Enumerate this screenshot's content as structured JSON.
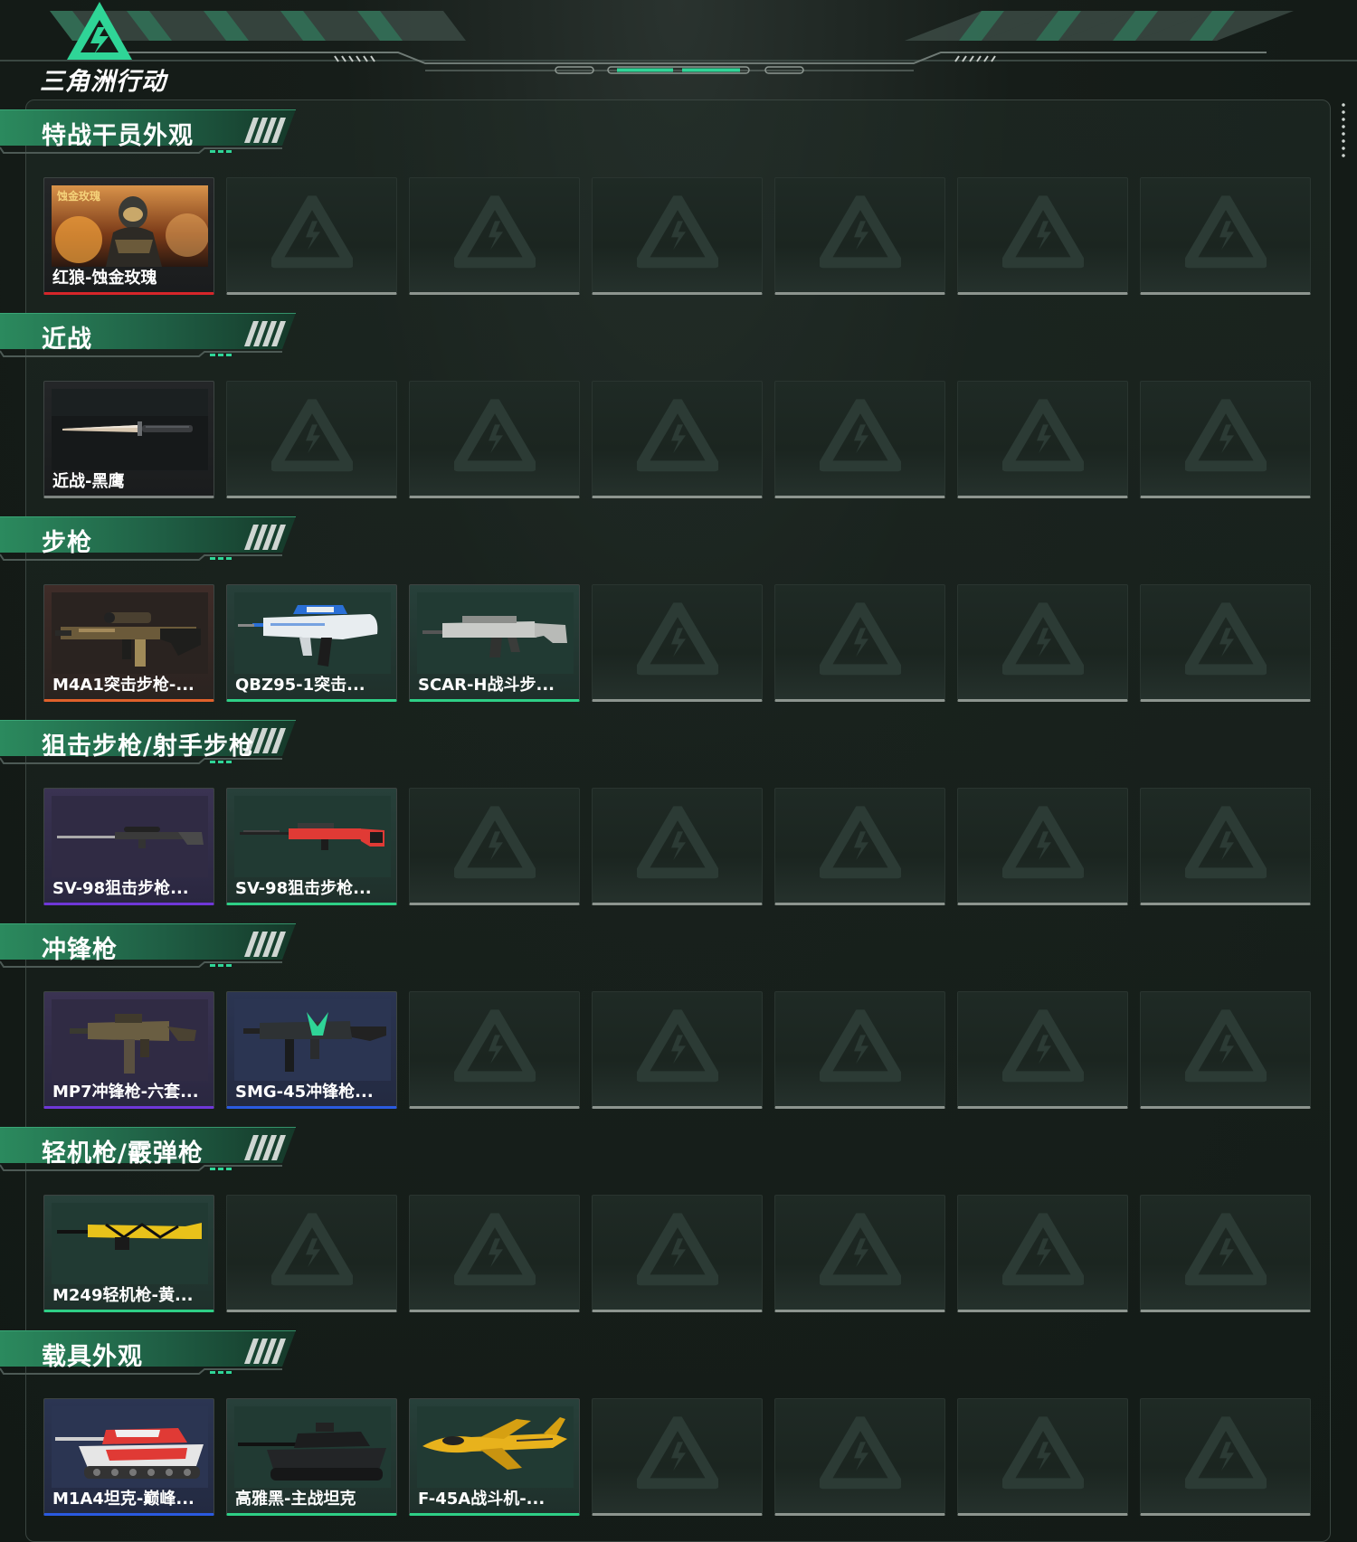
{
  "app": {
    "logo_text": "三角洲行动"
  },
  "theme": {
    "accent": "#2fd597",
    "panel_border": "#3a4540"
  },
  "sections": [
    {
      "title": "特战干员外观",
      "items": [
        {
          "label": "红狼-蚀金玫瑰",
          "rarity": "red",
          "bg": "dark",
          "thumb": "operator"
        },
        null,
        null,
        null,
        null,
        null,
        null
      ]
    },
    {
      "title": "近战",
      "items": [
        {
          "label": "近战-黑鹰",
          "rarity": "gray",
          "bg": "dark",
          "thumb": "knife"
        },
        null,
        null,
        null,
        null,
        null,
        null
      ]
    },
    {
      "title": "步枪",
      "items": [
        {
          "label": "M4A1突击步枪-...",
          "rarity": "orange",
          "bg": "orange",
          "thumb": "rifle-camo"
        },
        {
          "label": "QBZ95-1突击...",
          "rarity": "green",
          "bg": "green",
          "thumb": "rifle-bullpup"
        },
        {
          "label": "SCAR-H战斗步...",
          "rarity": "green",
          "bg": "green",
          "thumb": "rifle-scar"
        },
        null,
        null,
        null,
        null
      ]
    },
    {
      "title": "狙击步枪/射手步枪",
      "items": [
        {
          "label": "SV-98狙击步枪...",
          "rarity": "purple",
          "bg": "purple",
          "thumb": "sniper-dark"
        },
        {
          "label": "SV-98狙击步枪...",
          "rarity": "green",
          "bg": "green",
          "thumb": "sniper-red"
        },
        null,
        null,
        null,
        null,
        null
      ]
    },
    {
      "title": "冲锋枪",
      "items": [
        {
          "label": "MP7冲锋枪-六套...",
          "rarity": "purple",
          "bg": "purple",
          "thumb": "smg-camo"
        },
        {
          "label": "SMG-45冲锋枪...",
          "rarity": "blue",
          "bg": "blue",
          "thumb": "smg-green"
        },
        null,
        null,
        null,
        null,
        null
      ]
    },
    {
      "title": "轻机枪/霰弹枪",
      "items": [
        {
          "label": "M249轻机枪-黄...",
          "rarity": "green",
          "bg": "green",
          "thumb": "lmg-yellow"
        },
        null,
        null,
        null,
        null,
        null,
        null
      ]
    },
    {
      "title": "载具外观",
      "items": [
        {
          "label": "M1A4坦克-巅峰...",
          "rarity": "blue",
          "bg": "blue",
          "thumb": "tank-red"
        },
        {
          "label": "高雅黑-主战坦克",
          "rarity": "green",
          "bg": "green",
          "thumb": "tank-black"
        },
        {
          "label": "F-45A战斗机-...",
          "rarity": "green",
          "bg": "green",
          "thumb": "jet-yellow"
        },
        null,
        null,
        null,
        null
      ]
    }
  ]
}
